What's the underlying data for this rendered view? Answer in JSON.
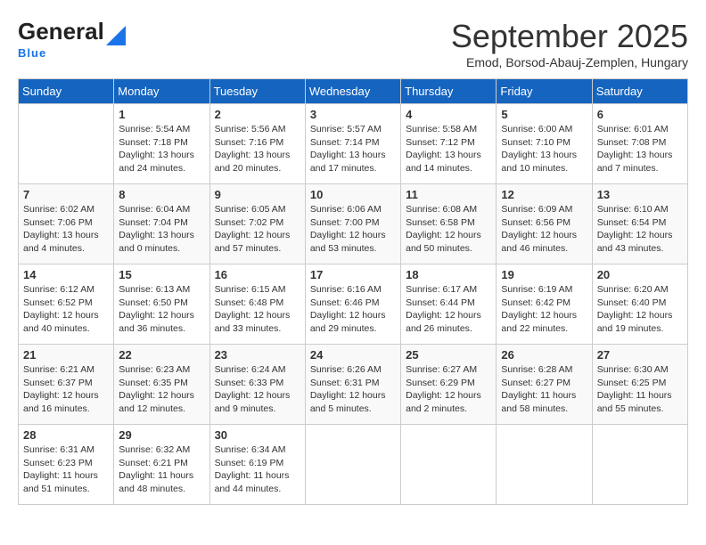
{
  "header": {
    "logo_general": "General",
    "logo_blue": "Blue",
    "month_title": "September 2025",
    "subtitle": "Emod, Borsod-Abauj-Zemplen, Hungary"
  },
  "weekdays": [
    "Sunday",
    "Monday",
    "Tuesday",
    "Wednesday",
    "Thursday",
    "Friday",
    "Saturday"
  ],
  "weeks": [
    [
      {
        "day": "",
        "info": ""
      },
      {
        "day": "1",
        "info": "Sunrise: 5:54 AM\nSunset: 7:18 PM\nDaylight: 13 hours\nand 24 minutes."
      },
      {
        "day": "2",
        "info": "Sunrise: 5:56 AM\nSunset: 7:16 PM\nDaylight: 13 hours\nand 20 minutes."
      },
      {
        "day": "3",
        "info": "Sunrise: 5:57 AM\nSunset: 7:14 PM\nDaylight: 13 hours\nand 17 minutes."
      },
      {
        "day": "4",
        "info": "Sunrise: 5:58 AM\nSunset: 7:12 PM\nDaylight: 13 hours\nand 14 minutes."
      },
      {
        "day": "5",
        "info": "Sunrise: 6:00 AM\nSunset: 7:10 PM\nDaylight: 13 hours\nand 10 minutes."
      },
      {
        "day": "6",
        "info": "Sunrise: 6:01 AM\nSunset: 7:08 PM\nDaylight: 13 hours\nand 7 minutes."
      }
    ],
    [
      {
        "day": "7",
        "info": "Sunrise: 6:02 AM\nSunset: 7:06 PM\nDaylight: 13 hours\nand 4 minutes."
      },
      {
        "day": "8",
        "info": "Sunrise: 6:04 AM\nSunset: 7:04 PM\nDaylight: 13 hours\nand 0 minutes."
      },
      {
        "day": "9",
        "info": "Sunrise: 6:05 AM\nSunset: 7:02 PM\nDaylight: 12 hours\nand 57 minutes."
      },
      {
        "day": "10",
        "info": "Sunrise: 6:06 AM\nSunset: 7:00 PM\nDaylight: 12 hours\nand 53 minutes."
      },
      {
        "day": "11",
        "info": "Sunrise: 6:08 AM\nSunset: 6:58 PM\nDaylight: 12 hours\nand 50 minutes."
      },
      {
        "day": "12",
        "info": "Sunrise: 6:09 AM\nSunset: 6:56 PM\nDaylight: 12 hours\nand 46 minutes."
      },
      {
        "day": "13",
        "info": "Sunrise: 6:10 AM\nSunset: 6:54 PM\nDaylight: 12 hours\nand 43 minutes."
      }
    ],
    [
      {
        "day": "14",
        "info": "Sunrise: 6:12 AM\nSunset: 6:52 PM\nDaylight: 12 hours\nand 40 minutes."
      },
      {
        "day": "15",
        "info": "Sunrise: 6:13 AM\nSunset: 6:50 PM\nDaylight: 12 hours\nand 36 minutes."
      },
      {
        "day": "16",
        "info": "Sunrise: 6:15 AM\nSunset: 6:48 PM\nDaylight: 12 hours\nand 33 minutes."
      },
      {
        "day": "17",
        "info": "Sunrise: 6:16 AM\nSunset: 6:46 PM\nDaylight: 12 hours\nand 29 minutes."
      },
      {
        "day": "18",
        "info": "Sunrise: 6:17 AM\nSunset: 6:44 PM\nDaylight: 12 hours\nand 26 minutes."
      },
      {
        "day": "19",
        "info": "Sunrise: 6:19 AM\nSunset: 6:42 PM\nDaylight: 12 hours\nand 22 minutes."
      },
      {
        "day": "20",
        "info": "Sunrise: 6:20 AM\nSunset: 6:40 PM\nDaylight: 12 hours\nand 19 minutes."
      }
    ],
    [
      {
        "day": "21",
        "info": "Sunrise: 6:21 AM\nSunset: 6:37 PM\nDaylight: 12 hours\nand 16 minutes."
      },
      {
        "day": "22",
        "info": "Sunrise: 6:23 AM\nSunset: 6:35 PM\nDaylight: 12 hours\nand 12 minutes."
      },
      {
        "day": "23",
        "info": "Sunrise: 6:24 AM\nSunset: 6:33 PM\nDaylight: 12 hours\nand 9 minutes."
      },
      {
        "day": "24",
        "info": "Sunrise: 6:26 AM\nSunset: 6:31 PM\nDaylight: 12 hours\nand 5 minutes."
      },
      {
        "day": "25",
        "info": "Sunrise: 6:27 AM\nSunset: 6:29 PM\nDaylight: 12 hours\nand 2 minutes."
      },
      {
        "day": "26",
        "info": "Sunrise: 6:28 AM\nSunset: 6:27 PM\nDaylight: 11 hours\nand 58 minutes."
      },
      {
        "day": "27",
        "info": "Sunrise: 6:30 AM\nSunset: 6:25 PM\nDaylight: 11 hours\nand 55 minutes."
      }
    ],
    [
      {
        "day": "28",
        "info": "Sunrise: 6:31 AM\nSunset: 6:23 PM\nDaylight: 11 hours\nand 51 minutes."
      },
      {
        "day": "29",
        "info": "Sunrise: 6:32 AM\nSunset: 6:21 PM\nDaylight: 11 hours\nand 48 minutes."
      },
      {
        "day": "30",
        "info": "Sunrise: 6:34 AM\nSunset: 6:19 PM\nDaylight: 11 hours\nand 44 minutes."
      },
      {
        "day": "",
        "info": ""
      },
      {
        "day": "",
        "info": ""
      },
      {
        "day": "",
        "info": ""
      },
      {
        "day": "",
        "info": ""
      }
    ]
  ]
}
